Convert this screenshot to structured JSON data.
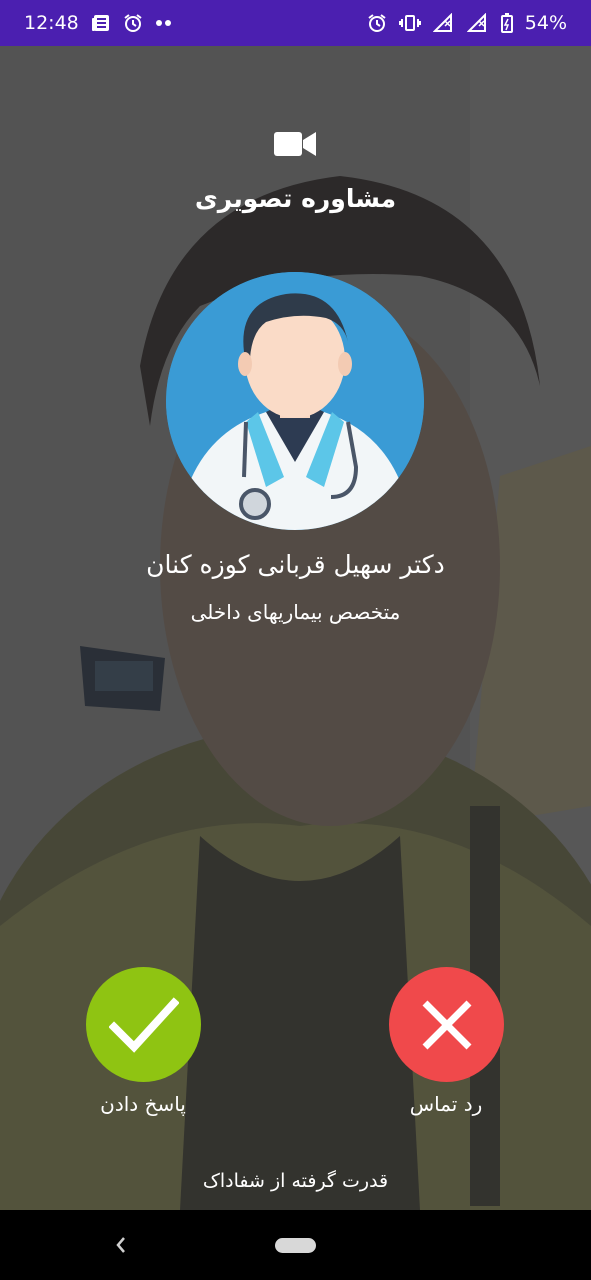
{
  "status_bar": {
    "time": "12:48",
    "battery": "54%",
    "left_icons": [
      "news-icon",
      "alarm-icon",
      "more-dots-icon"
    ],
    "right_icons": [
      "alarm-icon",
      "vibrate-icon",
      "signal-icon",
      "signal-x-icon",
      "battery-icon"
    ]
  },
  "call": {
    "type_icon": "video-camera-icon",
    "type_label": "مشاوره تصویری",
    "doctor_name": "دکتر سهیل قربانی کوزه کنان",
    "doctor_specialty": "متخصص بیماریهای داخلی",
    "avatar_icon": "doctor-avatar-icon"
  },
  "actions": {
    "answer_label": "پاسخ دادن",
    "answer_icon": "check-icon",
    "answer_color": "#8fc412",
    "decline_label": "رد تماس",
    "decline_icon": "close-icon",
    "decline_color": "#f0494b"
  },
  "footer": {
    "powered_by": "قدرت گرفته از شفاداک"
  },
  "nav": {
    "icons": [
      "back-icon",
      "home-pill-icon"
    ]
  },
  "theme": {
    "status_bar_color": "#4b1fb0",
    "avatar_bg": "#3a9bd5"
  }
}
